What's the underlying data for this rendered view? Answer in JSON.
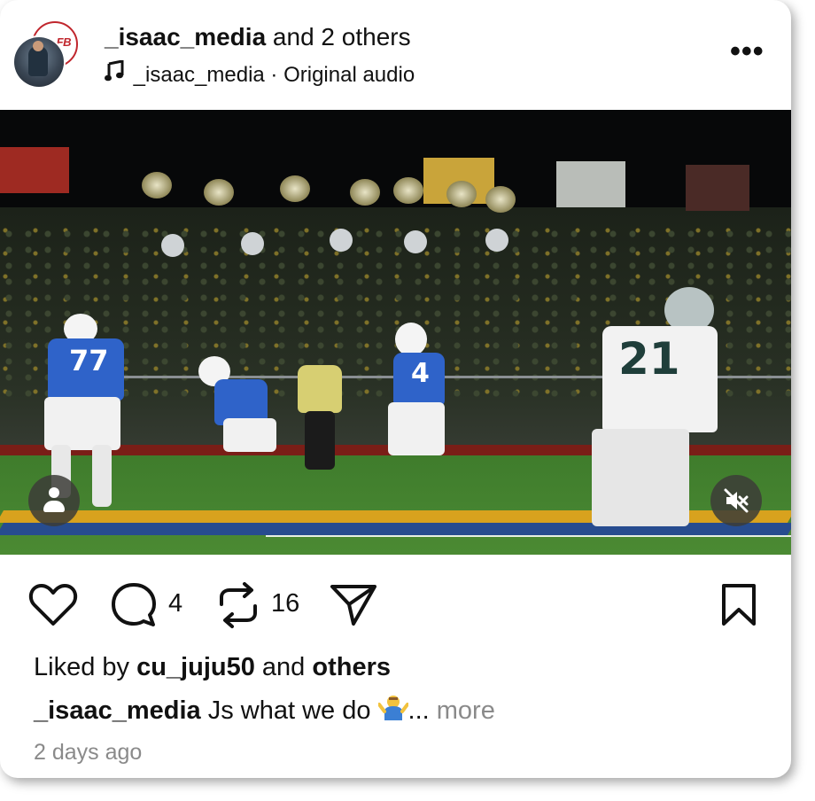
{
  "header": {
    "author": "_isaac_media",
    "author_suffix": " and 2 others",
    "audio_label": "_isaac_media · Original audio",
    "badge_text": "FB",
    "more_label": "•••"
  },
  "video": {
    "jersey_numbers": [
      "77",
      "4",
      "21"
    ],
    "muted": true
  },
  "actions": {
    "comment_count": "4",
    "repost_count": "16"
  },
  "likes": {
    "prefix": "Liked by ",
    "user": "cu_juju50",
    "middle": " and ",
    "suffix": "others"
  },
  "caption": {
    "author": "_isaac_media",
    "text": " Js what we do ",
    "emoji": "🤷‍♂️",
    "ellipsis": "... ",
    "more": "more"
  },
  "timestamp": "2 days ago",
  "colors": {
    "text": "#111111",
    "muted_text": "#8a8a8a",
    "home_jersey": "#2f63c9",
    "away_jersey": "#f2f2f2"
  },
  "icons": [
    "heart-icon",
    "comment-icon",
    "repost-icon",
    "share-icon",
    "bookmark-icon",
    "music-note-icon",
    "more-icon",
    "person-icon",
    "mute-icon"
  ]
}
